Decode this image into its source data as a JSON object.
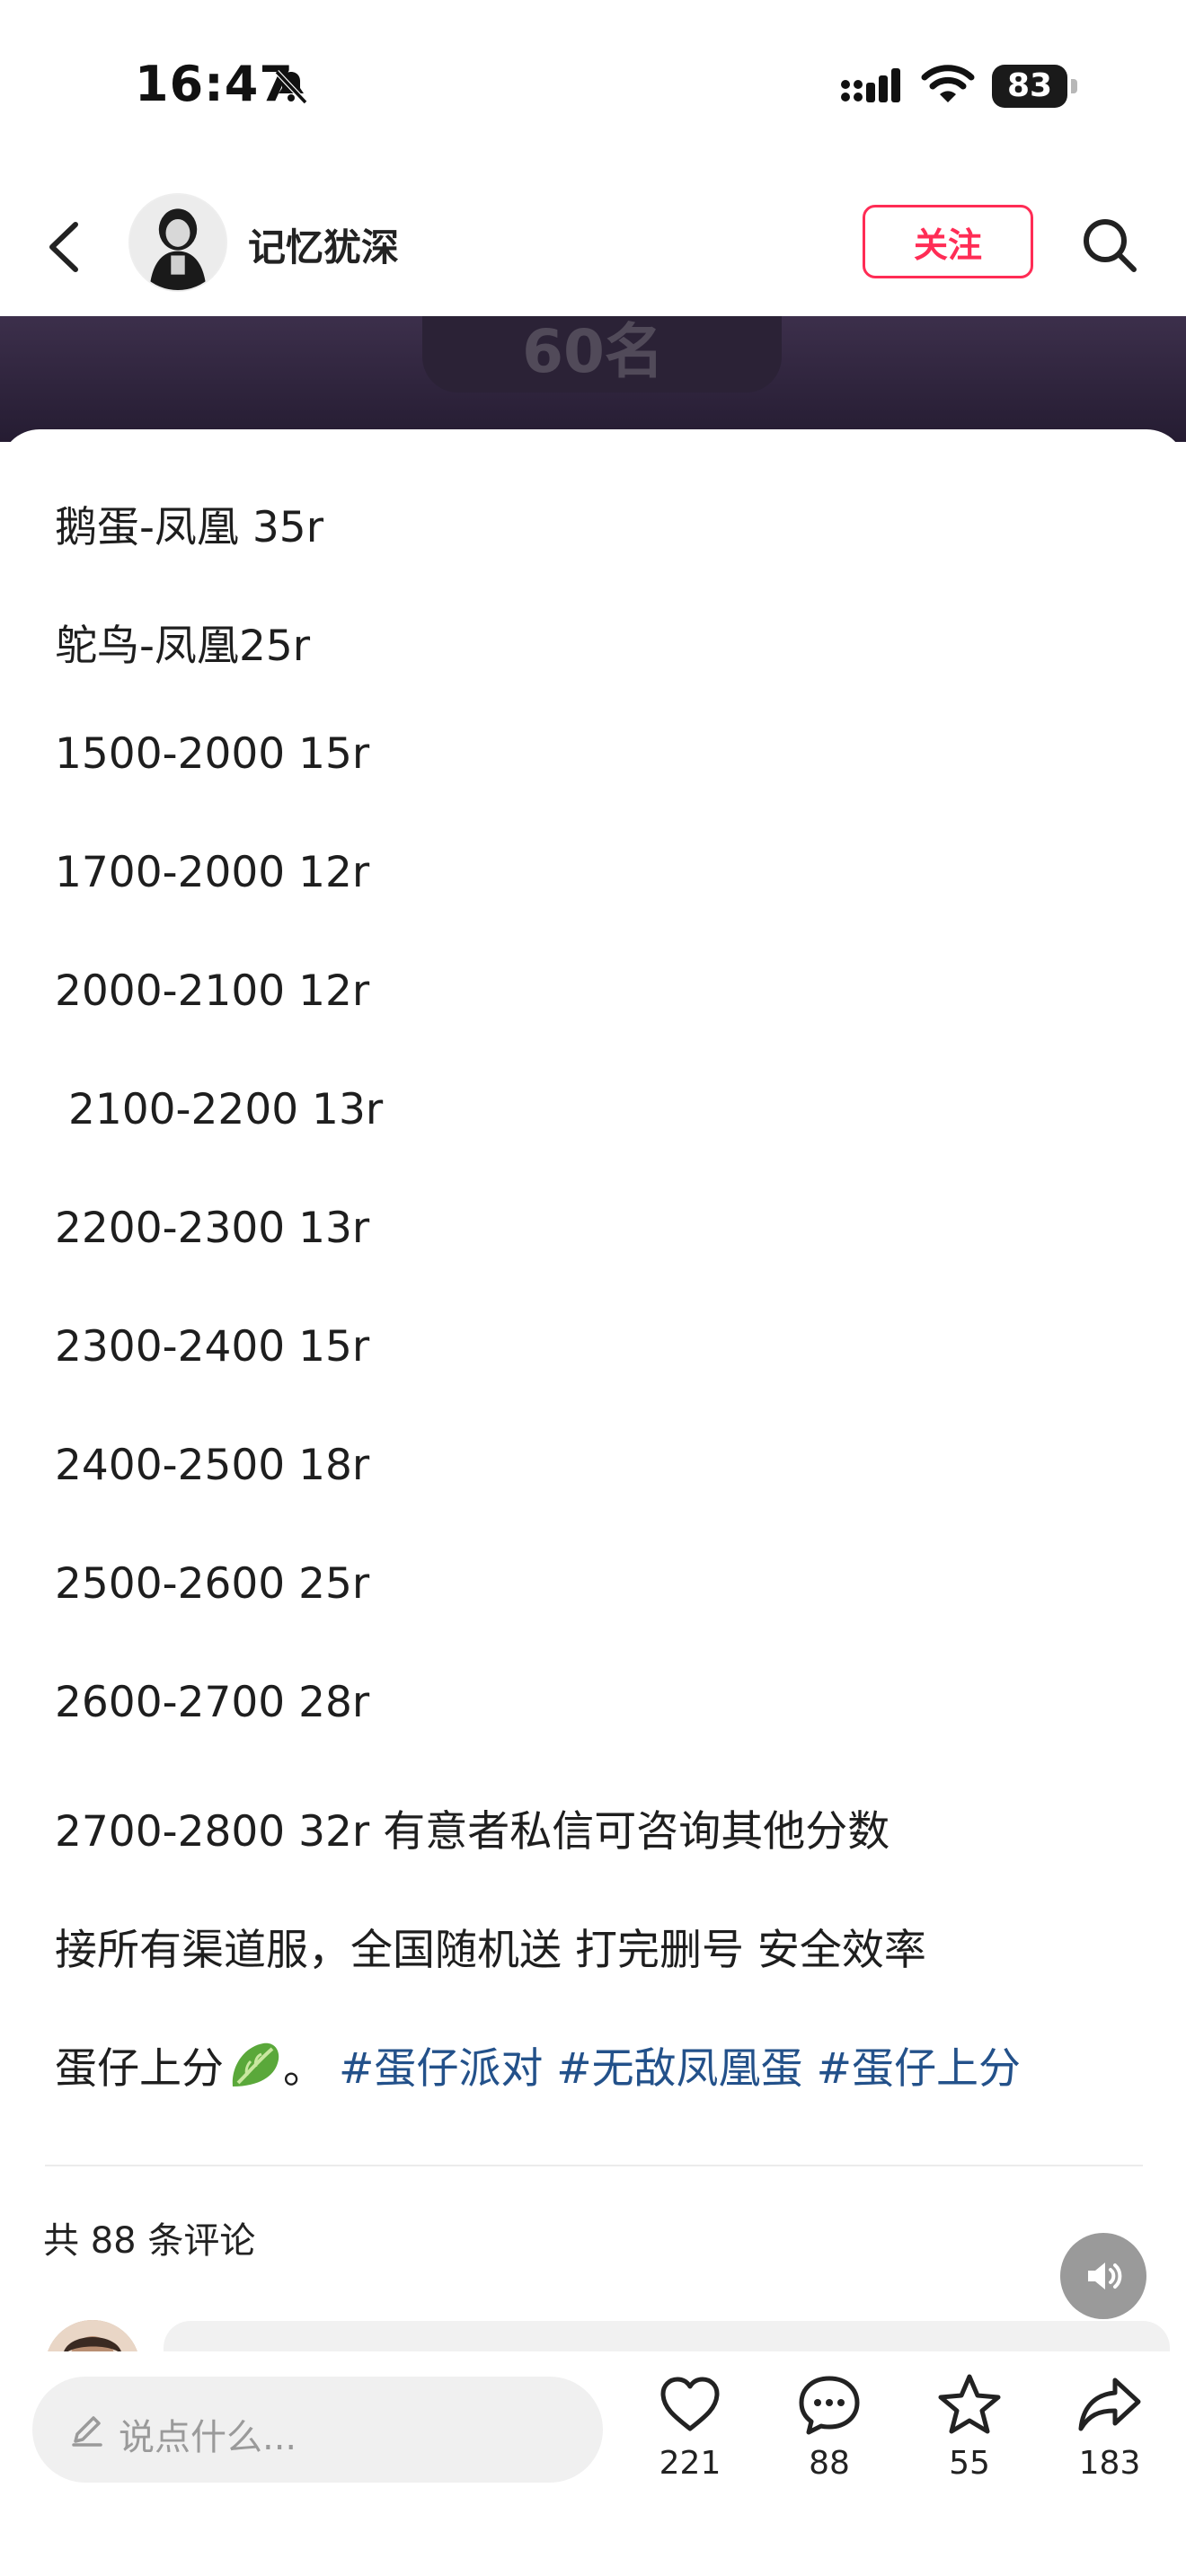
{
  "status_bar": {
    "time": "16:47",
    "battery": "83"
  },
  "header": {
    "username": "记忆犹深",
    "follow_label": "关注"
  },
  "hero": {
    "visible_text": "60名"
  },
  "post": {
    "lines": [
      "鹅蛋-凤凰 35r",
      "鸵鸟-凤凰25r",
      "1500-2000 15r",
      "1700-2000 12r",
      "2000-2100 12r",
      " 2100-2200 13r",
      "2200-2300 13r",
      "2300-2400 15r",
      "2400-2500 18r",
      "2500-2600 25r",
      "2600-2700 28r",
      "2700-2800 32r 有意者私信可咨询其他分数",
      "接所有渠道服，全国随机送 打完删号 安全效率"
    ],
    "last_line_text": "蛋仔上分",
    "last_line_punct": "。",
    "tags": [
      "#蛋仔派对",
      "#无敌凤凰蛋",
      "#蛋仔上分"
    ]
  },
  "comments": {
    "count_label": "共 88 条评论"
  },
  "bottom_bar": {
    "input_placeholder": "说点什么...",
    "likes": "221",
    "comments": "88",
    "favorites": "55",
    "shares": "183"
  },
  "colors": {
    "accent": "#ff2c55",
    "tag": "#23518a"
  }
}
